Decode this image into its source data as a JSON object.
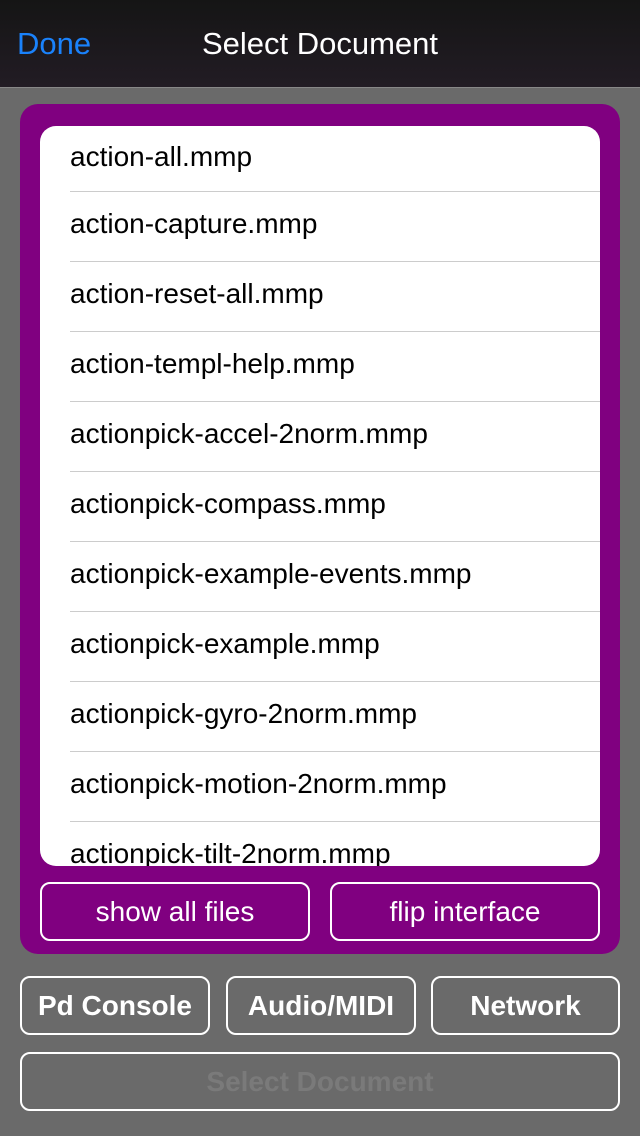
{
  "nav": {
    "done": "Done",
    "title": "Select Document"
  },
  "files": [
    "action-all.mmp",
    "action-capture.mmp",
    "action-reset-all.mmp",
    "action-templ-help.mmp",
    "actionpick-accel-2norm.mmp",
    "actionpick-compass.mmp",
    "actionpick-example-events.mmp",
    "actionpick-example.mmp",
    "actionpick-gyro-2norm.mmp",
    "actionpick-motion-2norm.mmp",
    "actionpick-tilt-2norm.mmp"
  ],
  "panel": {
    "show_all": "show all files",
    "flip": "flip interface"
  },
  "bottom": {
    "console": "Pd Console",
    "audio": "Audio/MIDI",
    "network": "Network",
    "select": "Select Document"
  },
  "colors": {
    "accent": "#1a82fb",
    "panel": "#800080",
    "background": "#6a6a6a"
  }
}
